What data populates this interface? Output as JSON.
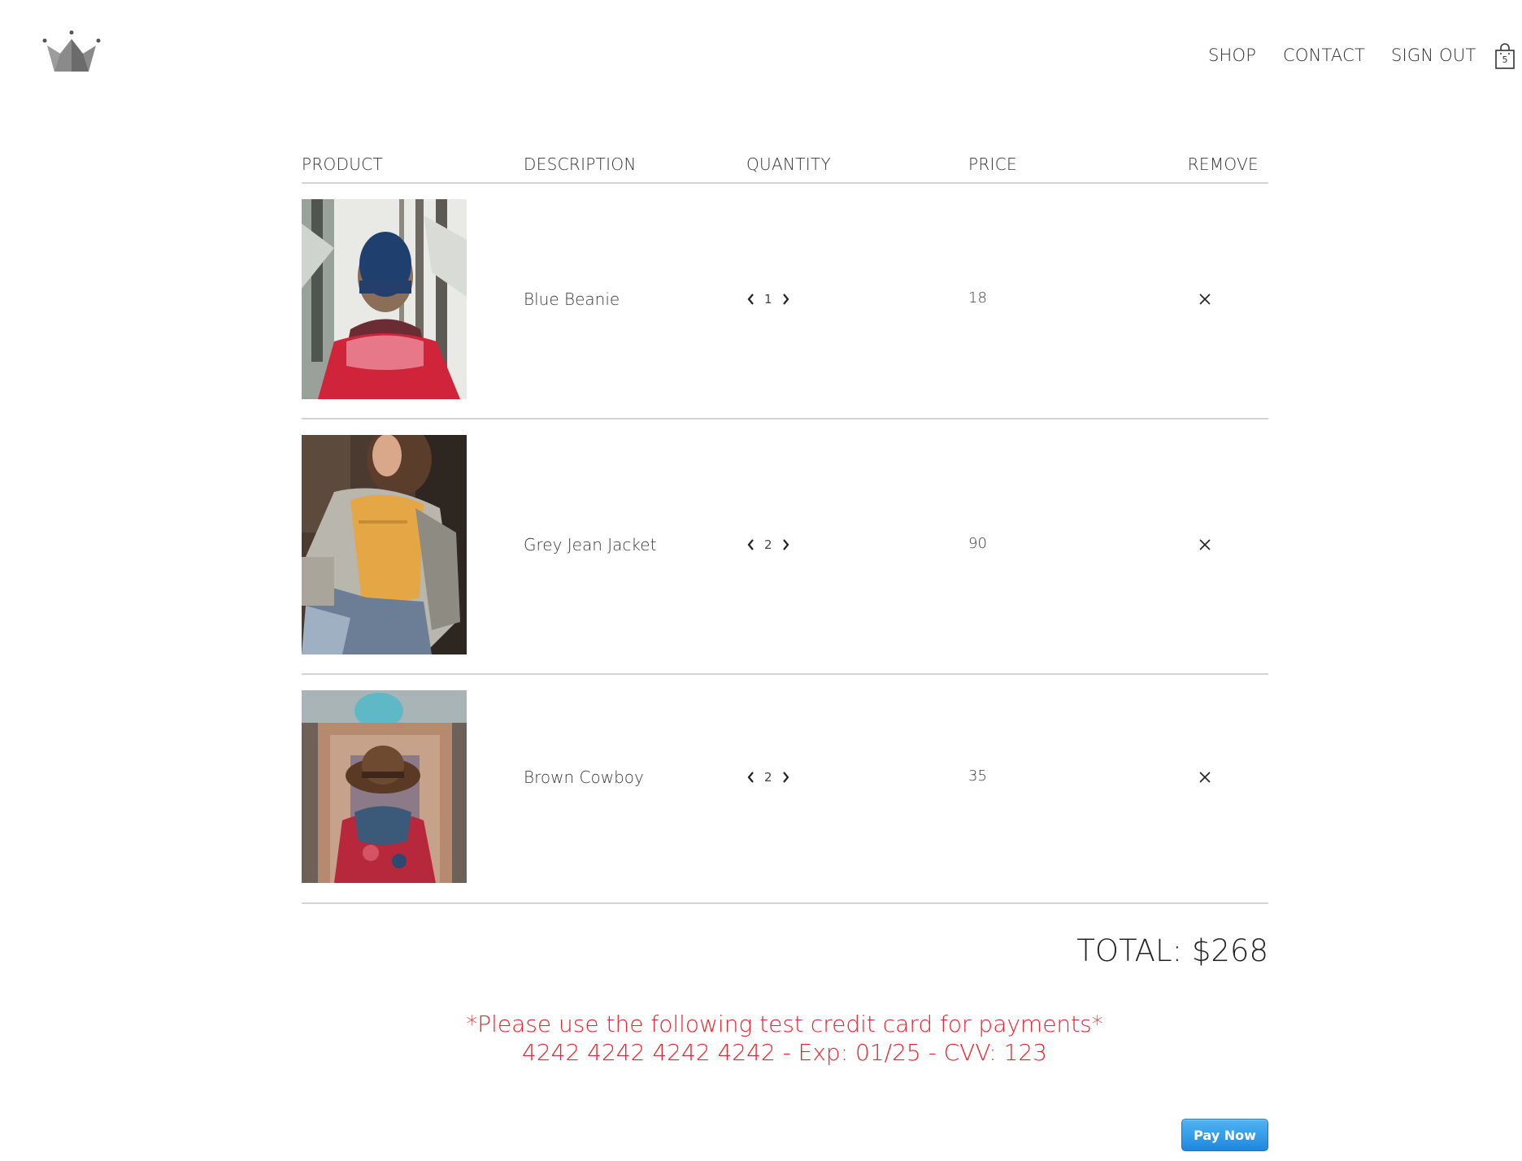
{
  "header": {
    "logo_icon": "crown-icon",
    "nav": {
      "shop": "SHOP",
      "contact": "CONTACT",
      "sign_out": "SIGN OUT"
    },
    "cart": {
      "icon": "shopping-bag-icon",
      "count": "5"
    }
  },
  "table": {
    "columns": {
      "product": "PRODUCT",
      "description": "DESCRIPTION",
      "quantity": "QUANTITY",
      "price": "PRICE",
      "remove": "REMOVE"
    },
    "items": [
      {
        "image": "woman in blue beanie and red jacket in snowy forest",
        "description": "Blue Beanie",
        "quantity": "1",
        "price": "18"
      },
      {
        "image": "woman in grey denim jacket over orange t-shirt",
        "description": "Grey Jean Jacket",
        "quantity": "2",
        "price": "90"
      },
      {
        "image": "person in brown cowboy hat and red scarf before tiled building",
        "description": "Brown Cowboy",
        "quantity": "2",
        "price": "35"
      }
    ]
  },
  "total": "TOTAL: $268",
  "notice": {
    "line1": "*Please use the following test credit card for payments*",
    "line2": "4242 4242 4242 4242 - Exp: 01/25 - CVV: 123"
  },
  "pay_button": "Pay Now",
  "colors": {
    "notice": "#e8252b",
    "pay_button": "#2a8fe0",
    "divider": "#d4d4d4"
  }
}
